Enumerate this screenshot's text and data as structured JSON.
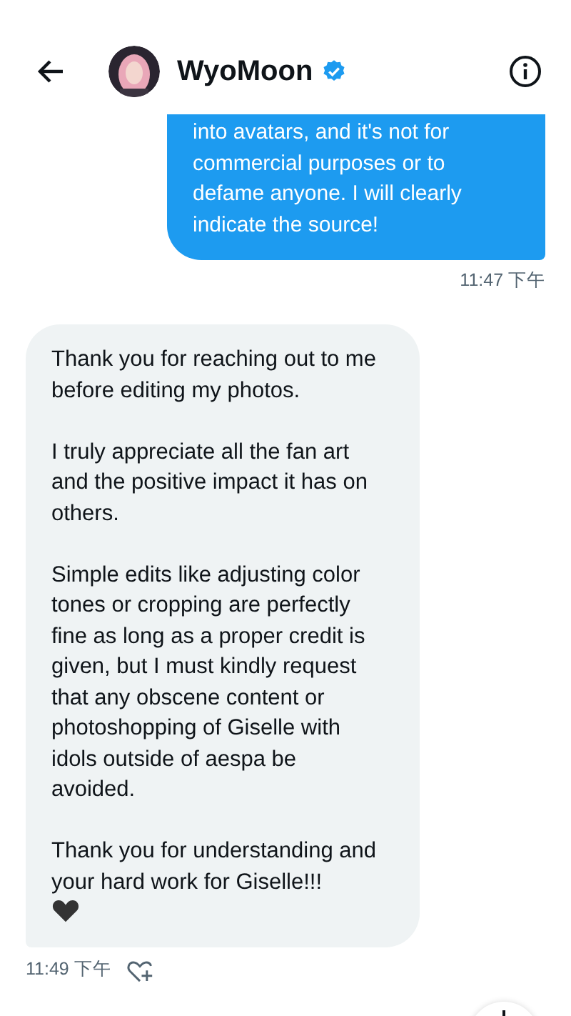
{
  "header": {
    "name": "WyoMoon",
    "verified": true
  },
  "messages": [
    {
      "kind": "sent",
      "paragraphs": [
        "into avatars, and it's not for commercial purposes or to defame anyone. I will clearly indicate the source!"
      ],
      "time": "11:47 下午"
    },
    {
      "kind": "received",
      "paragraphs": [
        "Thank you for reaching out to me before editing my photos.",
        "I truly appreciate all the fan art and the positive impact it has on others.",
        "Simple edits like adjusting color tones or cropping are perfectly fine as long as a proper credit is given, but I must kindly request that any obscene content or photoshopping of Giselle with idols outside of aespa be avoided.",
        "Thank you for understanding and your hard work for Giselle!!!"
      ],
      "heart": true,
      "time": "11:49 下午"
    }
  ]
}
